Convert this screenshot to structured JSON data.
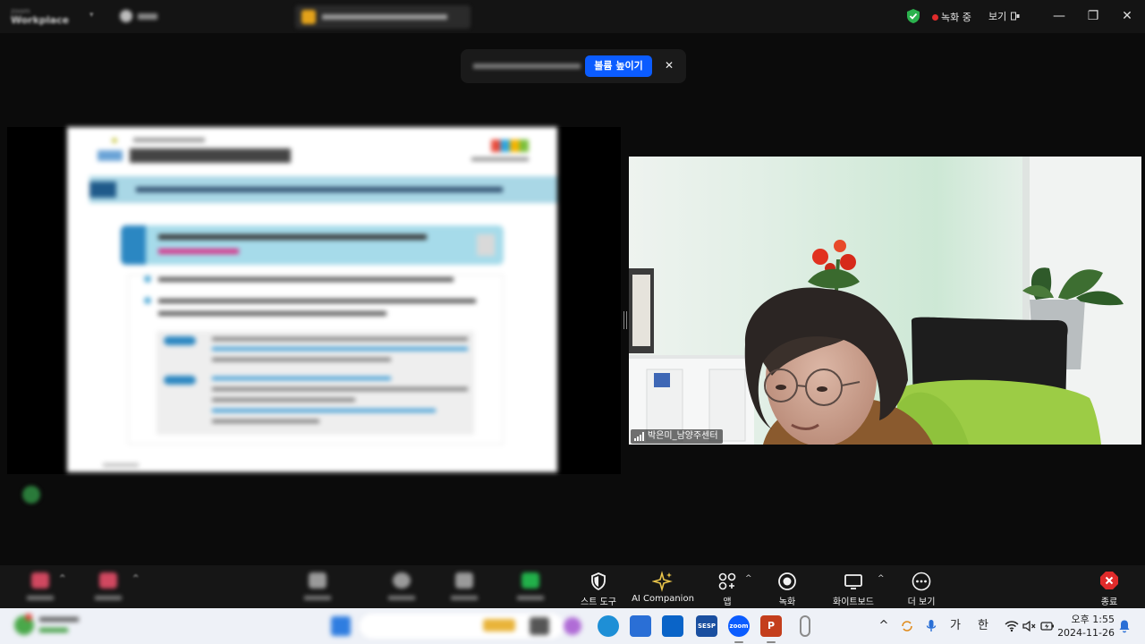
{
  "app": {
    "recording_label": "녹화 중",
    "view_label": "보기"
  },
  "notification": {
    "action_label": "볼륨 높이기",
    "close_glyph": "✕"
  },
  "window_controls": {
    "minimize": "—",
    "maximize": "❐",
    "close": "✕"
  },
  "participant": {
    "name": "박은미_남양주센터"
  },
  "toolbar": {
    "items": [
      {
        "label": "스트 도구",
        "icon": "shield-icon"
      },
      {
        "label": "AI Companion",
        "icon": "sparkle-icon"
      },
      {
        "label": "앱",
        "icon": "apps-icon"
      },
      {
        "label": "녹화",
        "icon": "record-icon"
      },
      {
        "label": "화이트보드",
        "icon": "whiteboard-icon"
      },
      {
        "label": "더 보기",
        "icon": "more-icon"
      }
    ],
    "end_label": "종료"
  },
  "taskbar": {
    "apps": [
      {
        "name": "edge-icon",
        "color": "#1e8fd6"
      },
      {
        "name": "store-icon",
        "color": "#2a6fd6"
      },
      {
        "name": "outlook-icon",
        "color": "#0a64c8"
      },
      {
        "name": "sesp-icon",
        "label": "SESP",
        "color": "#1a4fa0"
      },
      {
        "name": "zoom-icon",
        "label": "zoom",
        "color": "#0b5cff"
      },
      {
        "name": "powerpoint-icon",
        "label": "P",
        "color": "#c43e1c"
      },
      {
        "name": "microphone-app-icon",
        "color": "#8b8b8b"
      }
    ],
    "ime_hangul": "가",
    "ime_han": "한",
    "time": "오후 1:55",
    "date": "2024-11-26"
  },
  "colors": {
    "accent": "#0b5cff",
    "end_red": "#e02b2b",
    "shield_green": "#2bb14d"
  }
}
